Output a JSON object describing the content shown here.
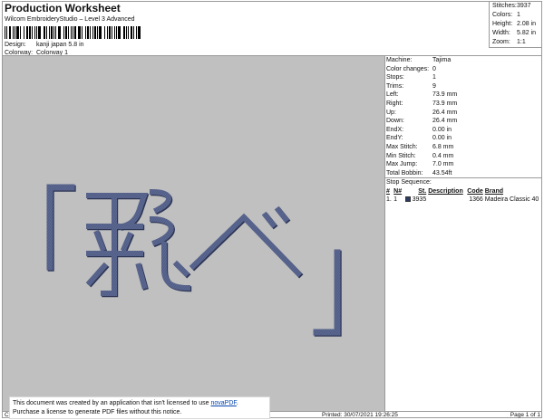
{
  "header": {
    "title": "Production Worksheet",
    "subtitle": "Wilcom EmbroideryStudio – Level 3 Advanced",
    "design_label": "Design:",
    "design_value": "kanji japan 5.8 in",
    "colorway_label": "Colorway:",
    "colorway_value": "Colorway 1"
  },
  "summary": [
    {
      "label": "Stitches:",
      "value": "3937"
    },
    {
      "label": "Colors:",
      "value": "1"
    },
    {
      "label": "Height:",
      "value": "2.08 in"
    },
    {
      "label": "Width:",
      "value": "5.82 in"
    },
    {
      "label": "Zoom:",
      "value": "1:1"
    }
  ],
  "machine_info": [
    {
      "label": "Machine:",
      "value": "Tajima"
    },
    {
      "label": "Color changes:",
      "value": "0"
    },
    {
      "label": "Stops:",
      "value": "1"
    },
    {
      "label": "Trims:",
      "value": "9"
    },
    {
      "label": "Left:",
      "value": "73.9 mm"
    },
    {
      "label": "Right:",
      "value": "73.9 mm"
    },
    {
      "label": "Up:",
      "value": "26.4 mm"
    },
    {
      "label": "Down:",
      "value": "26.4 mm"
    },
    {
      "label": "EndX:",
      "value": "0.00 in"
    },
    {
      "label": "EndY:",
      "value": "0.00 in"
    },
    {
      "label": "Max Stitch:",
      "value": "6.8 mm"
    },
    {
      "label": "Min Stitch:",
      "value": "0.4 mm"
    },
    {
      "label": "Max Jump:",
      "value": "7.0 mm"
    },
    {
      "label": "Total Bobbin:",
      "value": "43.54ft"
    }
  ],
  "stop_sequence": {
    "title": "Stop Sequence:",
    "columns": [
      "#",
      "N#",
      "St.",
      "Description",
      "Code",
      "Brand"
    ],
    "rows": [
      {
        "num": "1.",
        "needle": "1",
        "color": "#2d3a63",
        "stitches": "3935",
        "description": "",
        "code": "1366",
        "brand": "Madeira Classic 40"
      }
    ]
  },
  "design": {
    "background_color": "#c0c0c0",
    "thread_color": "#4f5b82",
    "thread_shadow": "#2c3454"
  },
  "footer": {
    "cr": "Cr",
    "printed": "Printed: 30/07/2021 19:26:25",
    "page": "Page 1 of 1"
  },
  "notice": {
    "line1_prefix": "This document was created by an application that isn't licensed to use ",
    "link_text": "novaPDF",
    "line1_suffix": ".",
    "line2": "Purchase a license to generate PDF files without this notice."
  }
}
